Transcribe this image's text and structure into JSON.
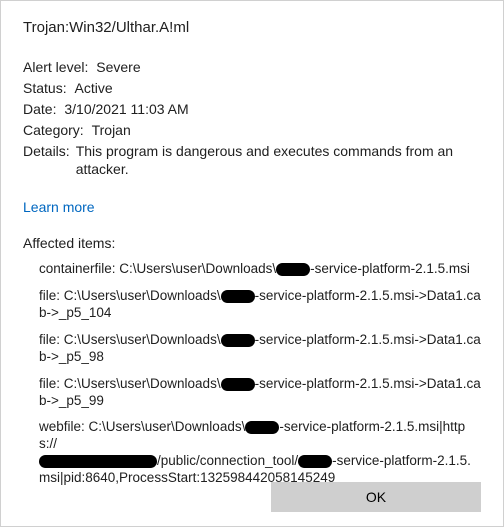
{
  "threat_name": "Trojan:Win32/Ulthar.A!ml",
  "meta": {
    "alert_level_label": "Alert level:",
    "alert_level_value": "Severe",
    "status_label": "Status:",
    "status_value": "Active",
    "date_label": "Date:",
    "date_value": "3/10/2021 11:03 AM",
    "category_label": "Category:",
    "category_value": "Trojan",
    "details_label": "Details:",
    "details_value": "This program is dangerous and executes commands from an attacker."
  },
  "learn_more": "Learn more",
  "affected_heading": "Affected items:",
  "items": [
    {
      "prefix": "containerfile: C:\\Users\\user\\Downloads\\",
      "mid": "-service-platform-2.1.5.msi",
      "suffix": ""
    },
    {
      "prefix": "file: C:\\Users\\user\\Downloads\\",
      "mid": "-service-platform-2.1.5.msi->Data1.cab->_p5_104",
      "suffix": ""
    },
    {
      "prefix": "file: C:\\Users\\user\\Downloads\\",
      "mid": "-service-platform-2.1.5.msi->Data1.cab->_p5_98",
      "suffix": ""
    },
    {
      "prefix": "file: C:\\Users\\user\\Downloads\\",
      "mid": "-service-platform-2.1.5.msi->Data1.cab->_p5_99",
      "suffix": ""
    },
    {
      "prefix": "webfile: C:\\Users\\user\\Downloads\\",
      "mid": "-service-platform-2.1.5.msi|https://",
      "tail_prefix": "/public/connection_tool/",
      "tail_mid": "-service-platform-2.1.5.msi|pid:8640,ProcessStart:132598442058145249"
    }
  ],
  "ok_label": "OK"
}
